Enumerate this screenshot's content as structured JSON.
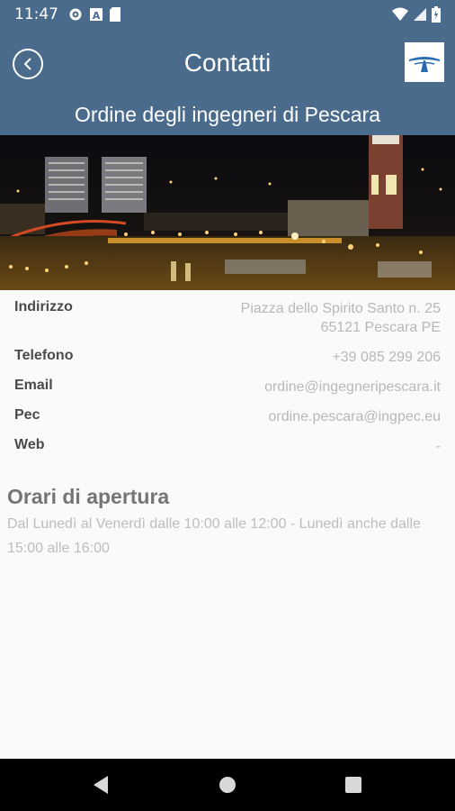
{
  "status_bar": {
    "time": "11:47"
  },
  "header": {
    "title": "Contatti",
    "subtitle": "Ordine degli ingegneri di Pescara"
  },
  "contact": [
    {
      "label": "Indirizzo",
      "value_line1": "Piazza dello Spirito Santo n. 25",
      "value_line2": "65121 Pescara PE"
    },
    {
      "label": "Telefono",
      "value": "+39 085 299 206"
    },
    {
      "label": "Email",
      "value": "ordine@ingegneripescara.it"
    },
    {
      "label": "Pec",
      "value": "ordine.pescara@ingpec.eu"
    },
    {
      "label": "Web",
      "value": "-"
    }
  ],
  "hours": {
    "title": "Orari di apertura",
    "text": "Dal Lunedì al Venerdì dalle 10:00 alle 12:00 - Lunedì anche dalle 15:00 alle 16:00"
  },
  "colors": {
    "primary": "#4a6b8c",
    "label": "#4a4a4a",
    "value": "#b8b8b8"
  }
}
